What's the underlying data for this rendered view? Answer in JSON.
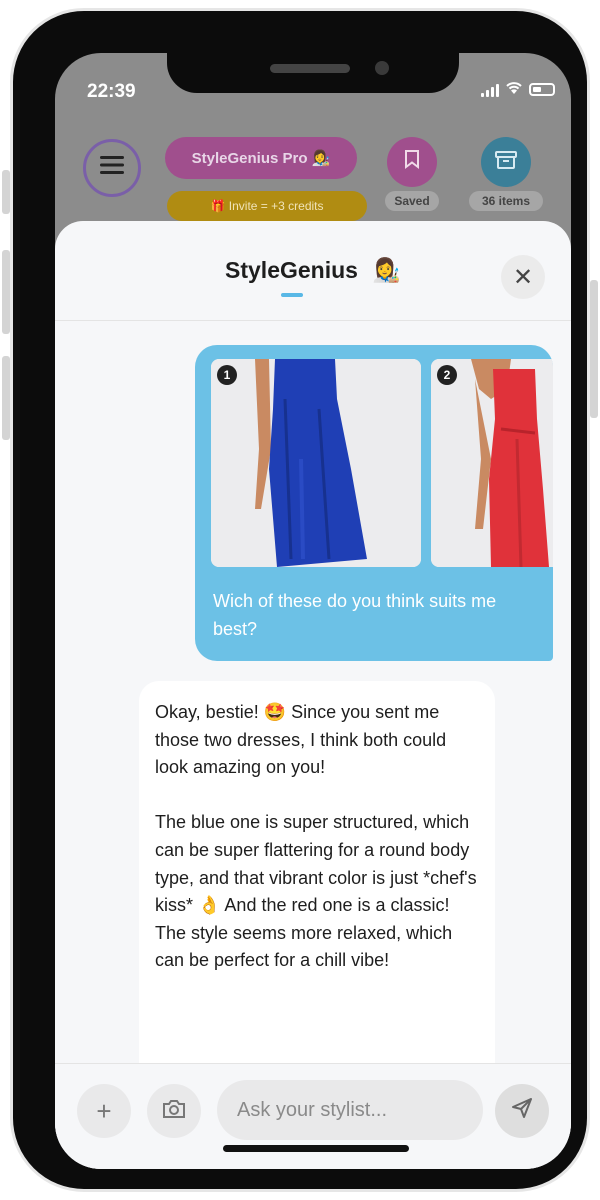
{
  "status_bar": {
    "time": "22:39"
  },
  "background": {
    "pro_label": "StyleGenius Pro 👩‍🎨",
    "invite_label": "🎁 Invite = +3 credits",
    "saved_label": "Saved",
    "items_label": "36 items"
  },
  "sheet": {
    "title": "StyleGenius",
    "avatar_emoji": "👩‍🎨",
    "close_glyph": "✕"
  },
  "chat": {
    "user_message": {
      "photo_numbers": [
        "1",
        "2"
      ],
      "text": "Wich of these do you think suits me best?"
    },
    "bot_message": {
      "paragraph_1": "Okay, bestie! 🤩 Since you sent me those two dresses, I think both could look amazing on you!",
      "paragraph_2": "The blue one is super structured, which can be super flattering for a round body type, and that vibrant color is just *chef's kiss* 👌 And the red one is a classic! The style seems more relaxed, which can be perfect for a chill vibe!"
    }
  },
  "composer": {
    "placeholder": "Ask your stylist...",
    "add_glyph": "+",
    "send_glyph": "➤"
  },
  "colors": {
    "user_bubble": "#6cc1e6",
    "blue_dress": "#1f3fb5",
    "red_dress": "#e0323a",
    "accent": "#59b8e6"
  },
  "icons": [
    "menu-icon",
    "bookmark-icon",
    "box-icon",
    "close-icon",
    "plus-icon",
    "camera-icon",
    "send-icon"
  ]
}
